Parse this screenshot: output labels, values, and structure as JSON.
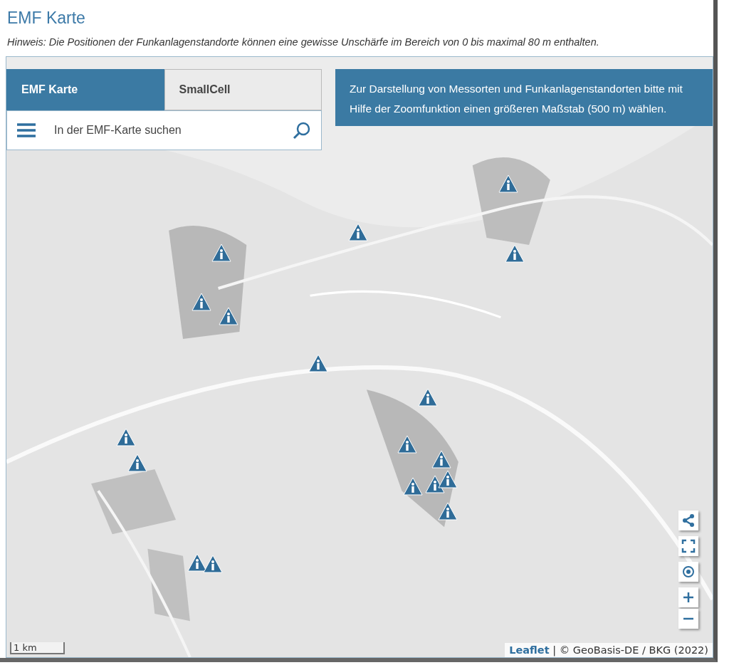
{
  "page": {
    "title": "EMF Karte",
    "hint": "Hinweis: Die Positionen der Funkanlagenstandorte können eine gewisse Unschärfe im Bereich von 0 bis maximal 80 m enthalten."
  },
  "map": {
    "tabs": [
      {
        "label": "EMF Karte",
        "selected": true
      },
      {
        "label": "SmallCell",
        "selected": false
      }
    ],
    "search": {
      "placeholder": "In der EMF-Karte suchen"
    },
    "notice": "Zur Darstellung von Messorten und Funkanlagenstandorten bitte mit Hilfe der Zoomfunktion einen größeren Maßstab (500 m) wählen.",
    "controls": [
      {
        "kind": "share"
      },
      {
        "kind": "fullscreen"
      },
      {
        "kind": "locate"
      },
      {
        "kind": "zoom-in"
      },
      {
        "kind": "zoom-out"
      }
    ],
    "scale": "1 km",
    "attribution": {
      "link": "Leaflet",
      "text": "| © GeoBasis-DE / BKG (2022)"
    }
  }
}
